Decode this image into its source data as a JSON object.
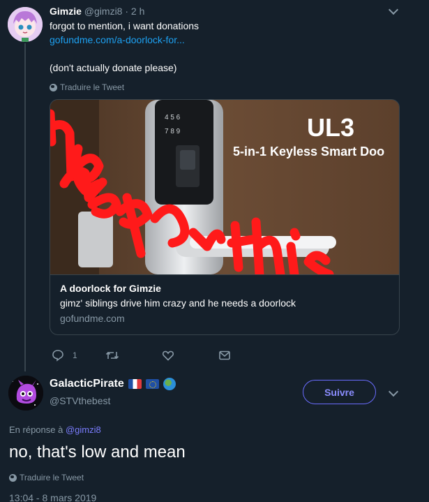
{
  "tweet1": {
    "name": "Gimzie",
    "handle": "@gimzi8",
    "separator": " · ",
    "time": "2 h",
    "line1": "forgot to mention, i want donations",
    "link": "gofundme.com/a-doorlock-for...",
    "line3": "(don't actually donate please)",
    "translate": "Traduire le Tweet",
    "card": {
      "image_label": "UL3",
      "image_subtitle": "5-in-1 Keyless Smart Doo",
      "title": "A doorlock for Gimzie",
      "description": "gimz' siblings drive him crazy and he needs a doorlock",
      "domain": "gofundme.com"
    },
    "reply_count": "1"
  },
  "tweet2": {
    "name": "GalacticPirate",
    "handle": "@STVthebest",
    "follow_label": "Suivre",
    "reply_prefix": "En réponse à",
    "reply_mention": "@gimzi8",
    "text": "no, that's low and mean",
    "translate": "Traduire le Tweet",
    "timestamp": "13:04 - 8 mars 2019"
  },
  "colors": {
    "background": "#15202b",
    "accent_link": "#1da1f2",
    "follow_accent": "#6a6cff",
    "muted": "#8899a6",
    "scribble": "#ff1a1a"
  },
  "icons": [
    "chevron-down-icon",
    "globe-icon",
    "reply-icon",
    "retweet-icon",
    "like-icon",
    "dm-icon",
    "flag-france-icon",
    "flag-eu-icon",
    "earth-globe-icon"
  ]
}
